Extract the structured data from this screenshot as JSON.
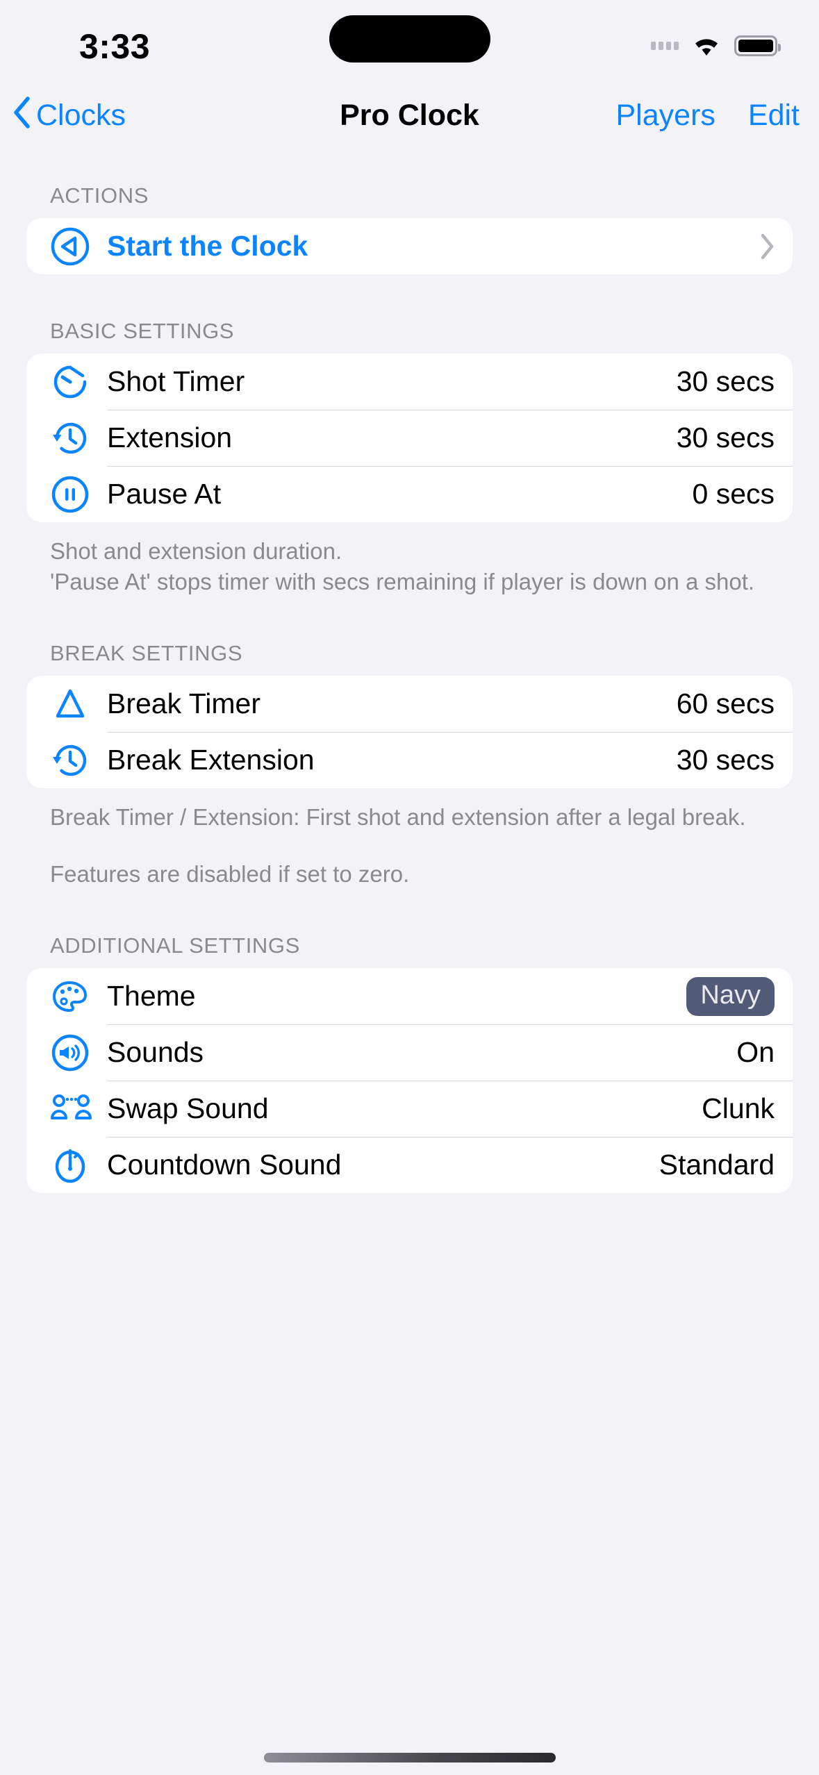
{
  "status_bar": {
    "time": "3:33",
    "cellular_icon": "signal-dots-icon",
    "wifi_icon": "wifi-icon",
    "battery_icon": "battery-full-icon"
  },
  "nav": {
    "back_icon": "chevron-left-icon",
    "back_label": "Clocks",
    "title": "Pro Clock",
    "players_label": "Players",
    "edit_label": "Edit"
  },
  "sections": [
    {
      "header": "ACTIONS",
      "rows": [
        {
          "icon": "play-circle-icon",
          "label": "Start the Clock",
          "value": "",
          "chevron": "chevron-right-icon"
        }
      ],
      "footnote": ""
    },
    {
      "header": "BASIC SETTINGS",
      "rows": [
        {
          "icon": "stopwatch-icon",
          "label": "Shot Timer",
          "value": "30 secs"
        },
        {
          "icon": "clock-arrow-icon",
          "label": "Extension",
          "value": "30 secs"
        },
        {
          "icon": "pause-circle-icon",
          "label": "Pause At",
          "value": "0 secs"
        }
      ],
      "footnote": "Shot and extension duration.\n'Pause At' stops timer with secs remaining if player is down on a shot."
    },
    {
      "header": "BREAK SETTINGS",
      "rows": [
        {
          "icon": "triangle-rack-icon",
          "label": "Break Timer",
          "value": "60 secs"
        },
        {
          "icon": "clock-arrow-icon",
          "label": "Break Extension",
          "value": "30 secs"
        }
      ],
      "footnote": "Break Timer / Extension: First shot and extension after a legal break.",
      "footnote_2": "Features are disabled if set to zero."
    },
    {
      "header": "ADDITIONAL SETTINGS",
      "rows": [
        {
          "icon": "palette-icon",
          "label": "Theme",
          "value": "Navy",
          "value_style": "badge"
        },
        {
          "icon": "speaker-wave-icon",
          "label": "Sounds",
          "value": "On"
        },
        {
          "icon": "two-people-icon",
          "label": "Swap Sound",
          "value": "Clunk"
        },
        {
          "icon": "timer-icon",
          "label": "Countdown Sound",
          "value": "Standard"
        }
      ],
      "footnote": ""
    }
  ],
  "colors": {
    "accent": "#0a84ff",
    "background": "#f2f2f7",
    "card": "#ffffff",
    "badge_navy": "#515b78",
    "secondary_text": "#8a8a8e"
  }
}
